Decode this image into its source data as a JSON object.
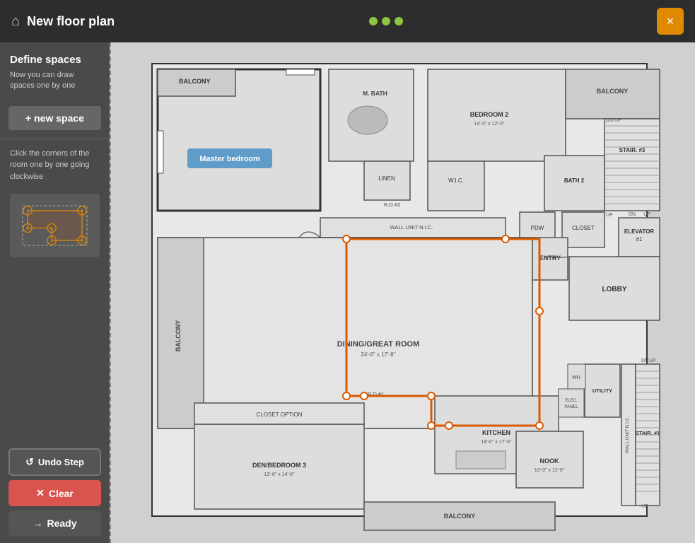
{
  "titlebar": {
    "title": "New floor plan",
    "close_label": "×",
    "dots": [
      "green",
      "green",
      "green"
    ]
  },
  "sidebar": {
    "define_title": "Define spaces",
    "define_desc": "Now you can draw spaces one by one",
    "new_space_label": "+ new space",
    "instructions": "Click the corners of the room one by one going clockwise",
    "undo_label": "Undo Step",
    "clear_label": "Clear",
    "ready_label": "Ready"
  },
  "floorplan": {
    "master_bedroom_label": "Master bedroom",
    "rooms": [
      "BALCONY",
      "M. BATH",
      "BEDROOM 2",
      "BATH 2",
      "STAIR. #3",
      "ELEVATOR #1",
      "LOBBY",
      "DINING/GREAT ROOM",
      "ENTRY",
      "DEN/BEDROOM 3",
      "KITCHEN",
      "NOOK",
      "CLOSET",
      "PDW",
      "W.I.C.",
      "LINEN",
      "STAIR. #1",
      "R.D #2",
      "R.D #1",
      "WALL UNIT N.I.C.",
      "CLOSET OPTION",
      "UTILITY",
      "WH",
      "ELEC. PANEL"
    ]
  }
}
